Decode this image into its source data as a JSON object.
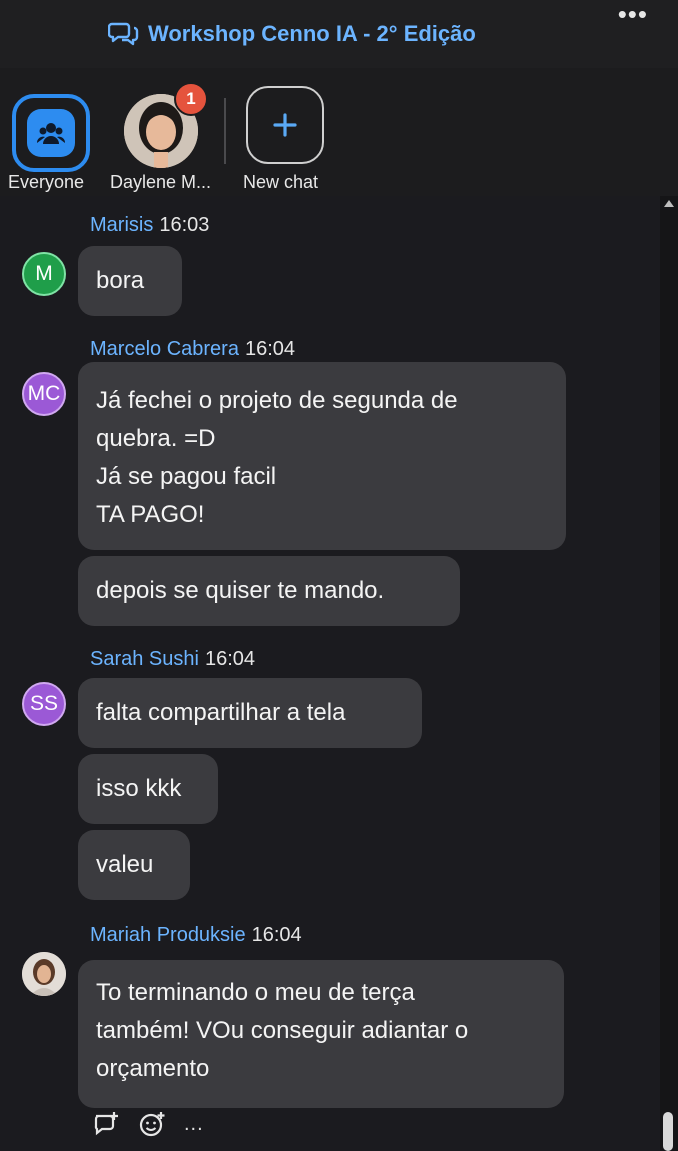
{
  "header": {
    "title": "Workshop Cenno IA - 2° Edição",
    "chat_icon": "chat-bubbles-icon",
    "more_label": "•••"
  },
  "recipients": {
    "items": [
      {
        "label": "Everyone",
        "icon": "people-icon"
      },
      {
        "label": "Daylene M...",
        "badge": "1"
      },
      {
        "label": "New chat",
        "icon": "plus-icon"
      }
    ]
  },
  "messages": [
    {
      "name": "Marisis",
      "time": "16:03",
      "avatar_text": "M",
      "avatar_color": "#1f9e4a",
      "bubbles": [
        "bora"
      ]
    },
    {
      "name": "Marcelo Cabrera",
      "time": "16:04",
      "avatar_text": "MC",
      "avatar_color": "#9b59d6",
      "bubbles": [
        "Já fechei o projeto de segunda de quebra. =D\nJá se pagou facil\nTA PAGO!",
        "depois se quiser te mando."
      ]
    },
    {
      "name": "Sarah Sushi",
      "time": "16:04",
      "avatar_text": "SS",
      "avatar_color": "#9b59d6",
      "bubbles": [
        "falta compartilhar a tela",
        "isso kkk",
        "valeu"
      ]
    },
    {
      "name": "Mariah Produksie",
      "time": "16:04",
      "avatar_text": "",
      "bubbles": [
        "To terminando o meu de terça também! VOu conseguir adiantar o orçamento"
      ]
    }
  ],
  "bubble_lines": {
    "marcelo_1": [
      "Já fechei o projeto de segunda de",
      "quebra. =D",
      "Já se pagou facil",
      "TA PAGO!"
    ],
    "mariah_1": [
      "To terminando o meu de terça",
      "também! VOu conseguir adiantar o",
      "orçamento"
    ]
  },
  "footer": {
    "more_label": "..."
  },
  "colors": {
    "accent": "#2d8cf0",
    "name": "#6cb4ff",
    "bubble": "#3b3b3f",
    "badge": "#e5533d"
  }
}
